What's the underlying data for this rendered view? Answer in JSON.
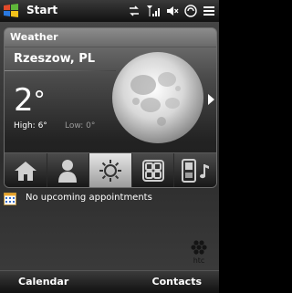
{
  "status_bar": {
    "title": "Start",
    "icons": [
      "sync-icon",
      "signal-icon",
      "speaker-muted-icon",
      "battery-icon",
      "menu-icon"
    ]
  },
  "weather": {
    "title": "Weather",
    "city": "Rzeszow, PL",
    "temperature": "2",
    "degree_symbol": "°",
    "high": "High: 6°",
    "low": "Low: 0°",
    "condition_icon": "full-moon-icon"
  },
  "tabs": [
    {
      "icon": "home-icon",
      "active": false
    },
    {
      "icon": "contacts-icon",
      "active": false
    },
    {
      "icon": "weather-sun-icon",
      "active": true
    },
    {
      "icon": "programs-icon",
      "active": false
    },
    {
      "icon": "music-phone-icon",
      "active": false
    }
  ],
  "appointments": {
    "text": "No upcoming appointments"
  },
  "softkeys": {
    "left": "Calendar",
    "right": "Contacts"
  }
}
